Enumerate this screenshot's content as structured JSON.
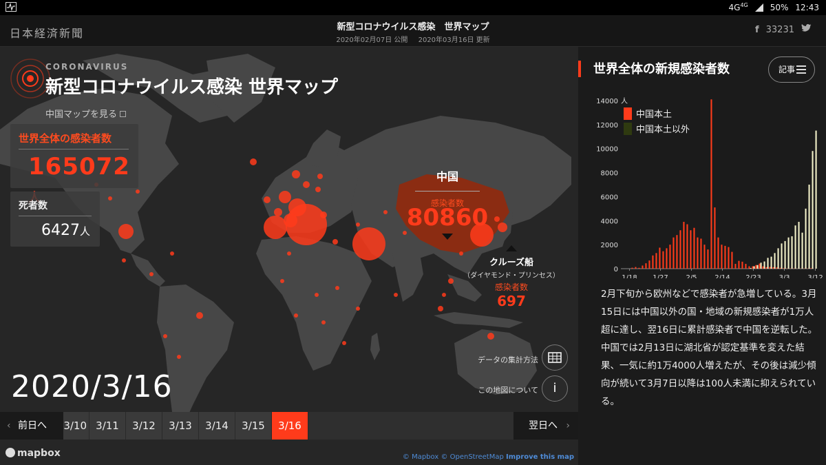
{
  "status_bar": {
    "network": "4G",
    "network_sup": "4G",
    "battery": "50%",
    "time": "12:43"
  },
  "header": {
    "logo": "日本経済新聞",
    "title": "新型コロナウイルス感染　世界マップ",
    "published": "2020年02月07日 公開",
    "updated": "2020年03月16日 更新",
    "facebook_icon": "f",
    "facebook_count": "33231",
    "twitter_icon": "twitter-bird"
  },
  "map": {
    "eyebrow": "CORONAVIRUS",
    "title": "新型コロナウイルス感染 世界マップ",
    "china_map_link": "中国マップを見る",
    "total_label": "世界全体の感染者数",
    "total_value": "165072",
    "total_unit": "人",
    "death_label": "死者数",
    "death_value": "6427",
    "death_unit": "人",
    "china_name": "中国",
    "china_sub": "感染者数",
    "china_value": "80860",
    "cruise_name": "クルーズ船",
    "cruise_sub": "（ダイヤモンド・プリンセス）",
    "cruise_label": "感染者数",
    "cruise_value": "697",
    "current_date": "2020/3/16",
    "method_label": "データの集計方法",
    "about_label": "この地図について",
    "about_icon": "i"
  },
  "timeline": {
    "prev": "前日へ",
    "next": "翌日へ",
    "dates": [
      "3/10",
      "3/11",
      "3/12",
      "3/13",
      "3/14",
      "3/15",
      "3/16"
    ],
    "active": "3/16"
  },
  "attribution": {
    "mapbox": "mapbox",
    "mapbox_copy": "© Mapbox",
    "osm": "© OpenStreetMap",
    "improve": "Improve this map"
  },
  "panel": {
    "title": "世界全体の新規感染者数",
    "article_button": "記事",
    "body": "2月下旬から欧州などで感染者が急増している。3月15日には中国以外の国・地域の新規感染者が1万人超に達し、翌16日に累計感染者で中国を逆転した。中国では2月13日に湖北省が認定基準を変えた結果、一気に約1万4000人増えたが、その後は減少傾向が続いて3月7日以降は100人未満に抑えられている。"
  },
  "colors": {
    "accent": "#ff3b1b",
    "outside_china": "#f2f0c8"
  },
  "chart_data": {
    "type": "bar",
    "title": "世界全体の新規感染者数",
    "ylabel": "人",
    "ylim": [
      0,
      14000
    ],
    "yticks": [
      0,
      2000,
      4000,
      6000,
      8000,
      10000,
      12000,
      14000
    ],
    "xticks": [
      "1/18",
      "1/27",
      "2/5",
      "2/14",
      "2/23",
      "3/3",
      "3/12"
    ],
    "legend_position": "top-left",
    "start_date": "1/16",
    "series": [
      {
        "name": "中国本土",
        "color": "#ff3b1b",
        "values": [
          0,
          0,
          0,
          80,
          140,
          70,
          260,
          450,
          680,
          1100,
          1300,
          1750,
          1450,
          1700,
          2000,
          2600,
          2800,
          3200,
          3900,
          3700,
          3200,
          3400,
          2600,
          2500,
          2000,
          1600,
          14100,
          5100,
          2600,
          2000,
          1900,
          1800,
          1400,
          400,
          650,
          580,
          400,
          200,
          200,
          300,
          420,
          190,
          120,
          140,
          120,
          100,
          70,
          40,
          20,
          20,
          20,
          10,
          10,
          20,
          20,
          40
        ]
      },
      {
        "name": "中国本土以外",
        "color": "#f2f0c8",
        "values": [
          0,
          0,
          0,
          0,
          0,
          0,
          0,
          0,
          0,
          0,
          0,
          0,
          0,
          0,
          0,
          0,
          0,
          0,
          0,
          0,
          0,
          0,
          0,
          0,
          0,
          0,
          0,
          0,
          0,
          0,
          0,
          0,
          0,
          0,
          0,
          0,
          0,
          50,
          200,
          300,
          500,
          600,
          900,
          1000,
          1300,
          1700,
          2100,
          2300,
          2600,
          2700,
          3600,
          3900,
          3000,
          5000,
          7000,
          9800,
          11500
        ]
      }
    ]
  }
}
